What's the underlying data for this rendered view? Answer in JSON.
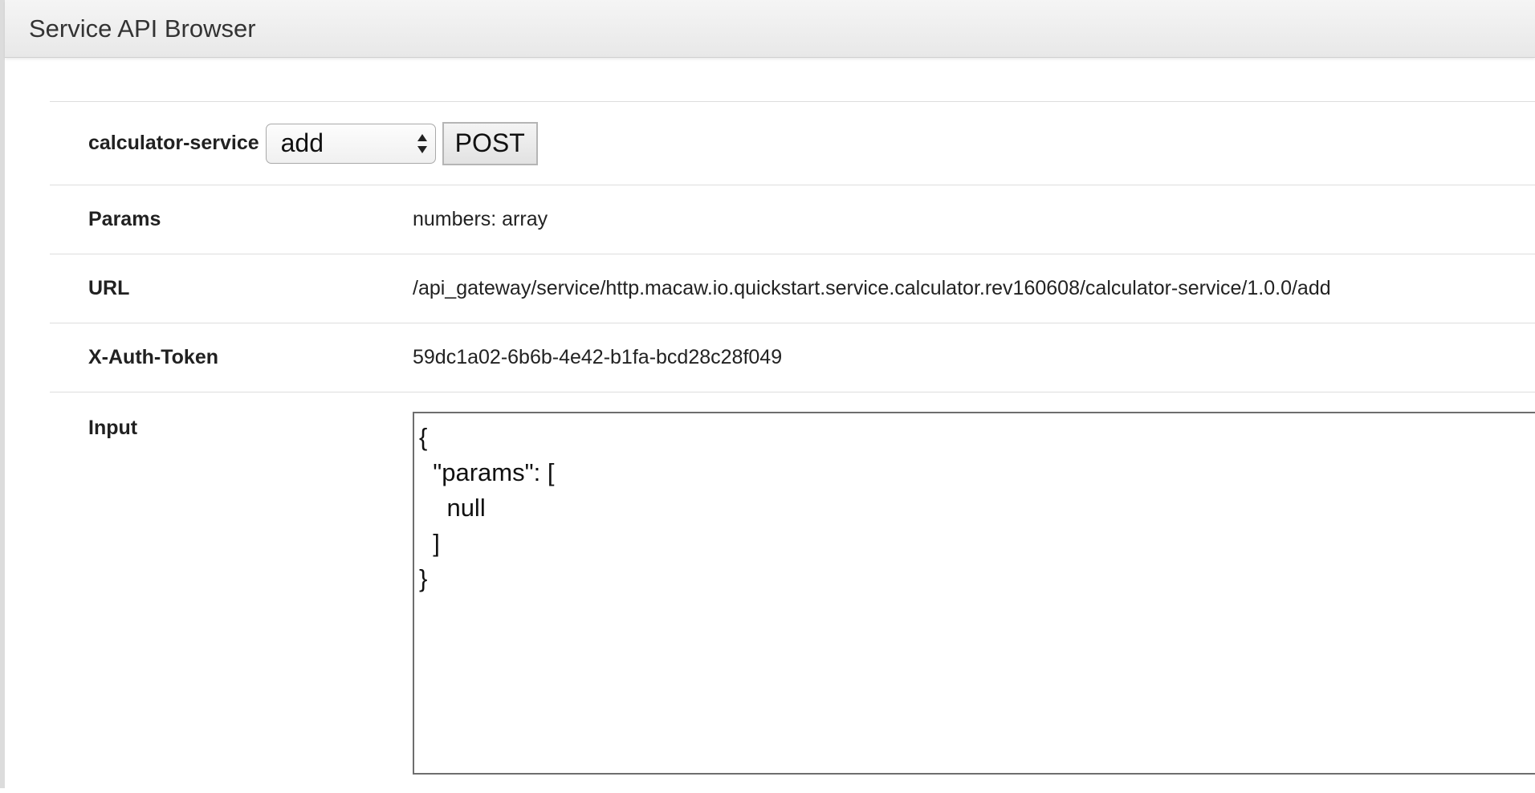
{
  "panel": {
    "title": "Service API Browser"
  },
  "service": {
    "name": "calculator-service",
    "method_selected": "add",
    "submit_label": "POST"
  },
  "fields": {
    "params_label": "Params",
    "params_value": "numbers: array",
    "url_label": "URL",
    "url_value": "/api_gateway/service/http.macaw.io.quickstart.service.calculator.rev160608/calculator-service/1.0.0/add",
    "token_label": "X-Auth-Token",
    "token_value": "59dc1a02-6b6b-4e42-b1fa-bcd28c28f049",
    "input_label": "Input",
    "input_value": "{\n  \"params\": [\n    null\n  ]\n}"
  },
  "icons": {
    "select_arrows": "up-down-arrows-icon"
  }
}
